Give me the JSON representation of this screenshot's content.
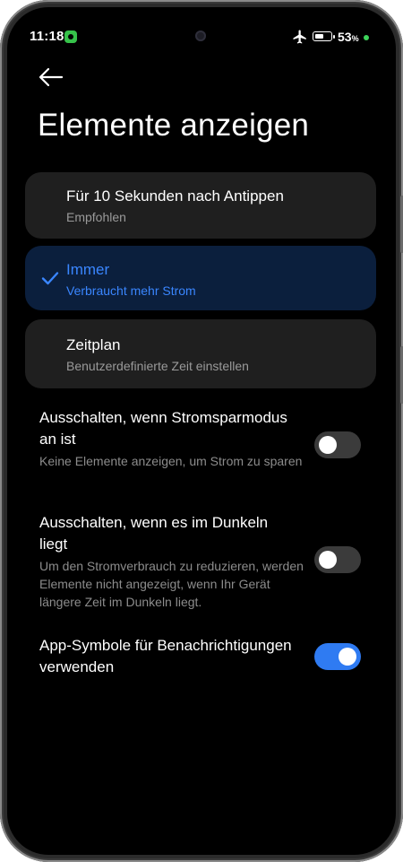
{
  "status_bar": {
    "time": "11:18",
    "battery_percent": "53",
    "battery_unit": "%",
    "icons": [
      "app-badge-icon",
      "airplane-icon",
      "battery-icon"
    ]
  },
  "header": {
    "title": "Elemente anzeigen",
    "back_icon": "arrow-left-icon"
  },
  "options": [
    {
      "title": "Für 10 Sekunden nach Antippen",
      "subtitle": "Empfohlen",
      "selected": false
    },
    {
      "title": "Immer",
      "subtitle": "Verbraucht mehr Strom",
      "selected": true
    },
    {
      "title": "Zeitplan",
      "subtitle": "Benutzerdefinierte Zeit einstellen",
      "selected": false
    }
  ],
  "settings": [
    {
      "title": "Ausschalten, wenn Stromsparmodus an ist",
      "description": "Keine Elemente anzeigen, um Strom zu sparen",
      "enabled": false
    },
    {
      "title": "Ausschalten, wenn es im Dunkeln liegt",
      "description": "Um den Stromverbrauch zu reduzieren, werden Elemente nicht angezeigt, wenn Ihr Gerät längere Zeit im Dunkeln liegt.",
      "enabled": false
    },
    {
      "title": "App-Symbole für Benachrichtigungen verwenden",
      "description": "",
      "enabled": true
    }
  ],
  "colors": {
    "accent": "#2f7bf2",
    "selected_text": "#3a86ff",
    "selected_card": "#0b1f3d",
    "card": "#1f1f1f",
    "background": "#000000"
  }
}
